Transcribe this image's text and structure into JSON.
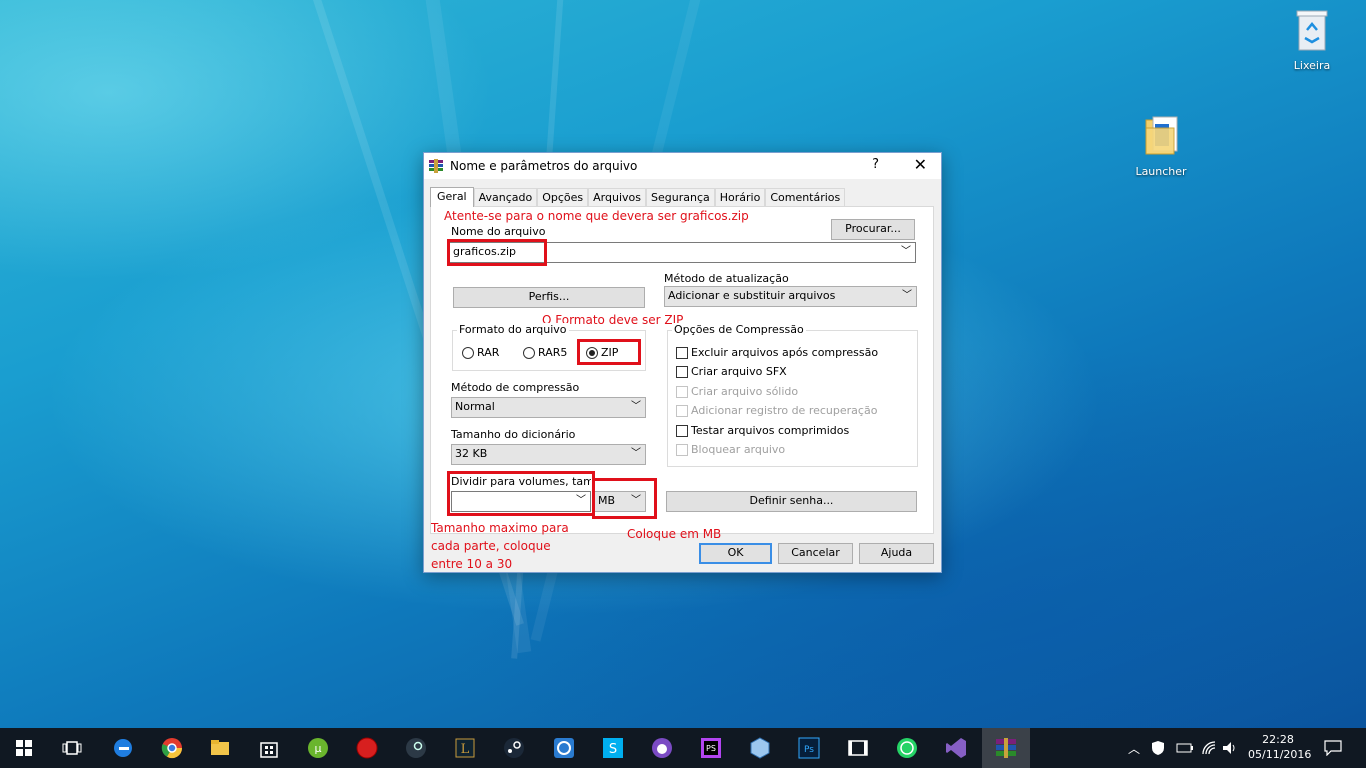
{
  "desktop": {
    "icons": [
      {
        "label": "Lixeira",
        "icon": "recycle-bin-icon"
      },
      {
        "label": "Launcher",
        "icon": "folder-icon"
      }
    ]
  },
  "dialog": {
    "title": "Nome e parâmetros do arquivo",
    "help_label": "?",
    "close_label": "✕",
    "tabs": [
      "Geral",
      "Avançado",
      "Opções",
      "Arquivos",
      "Segurança",
      "Horário",
      "Comentários"
    ],
    "active_tab": "Geral",
    "file_name_label": "Nome do arquivo",
    "file_name_value": "graficos.zip",
    "browse_button": "Procurar...",
    "profiles_button": "Perfis...",
    "update_method_label": "Método de atualização",
    "update_method_value": "Adicionar e substituir arquivos",
    "format_group_label": "Formato do arquivo",
    "formats": [
      {
        "label": "RAR",
        "selected": false
      },
      {
        "label": "RAR5",
        "selected": false
      },
      {
        "label": "ZIP",
        "selected": true
      }
    ],
    "compression_method_label": "Método de compressão",
    "compression_method_value": "Normal",
    "dictionary_size_label": "Tamanho do dicionário",
    "dictionary_size_value": "32 KB",
    "split_label": "Dividir para volumes, tamanho",
    "split_value": "",
    "split_unit": "MB",
    "options_group_label": "Opções de Compressão",
    "options": [
      {
        "label": "Excluir arquivos após compressão",
        "checked": false,
        "enabled": true
      },
      {
        "label": "Criar arquivo SFX",
        "checked": false,
        "enabled": true
      },
      {
        "label": "Criar arquivo sólido",
        "checked": false,
        "enabled": false
      },
      {
        "label": "Adicionar registro de recuperação",
        "checked": false,
        "enabled": false
      },
      {
        "label": "Testar arquivos comprimidos",
        "checked": false,
        "enabled": true
      },
      {
        "label": "Bloquear arquivo",
        "checked": false,
        "enabled": false
      }
    ],
    "set_password_button": "Definir senha...",
    "ok_button": "OK",
    "cancel_button": "Cancelar",
    "help_button": "Ajuda"
  },
  "annotations": {
    "name_note": "Atente-se para o nome que devera ser graficos.zip",
    "format_note": "O Formato deve ser ZIP",
    "size_note_line1": "Tamanho maximo para",
    "size_note_line2": "cada parte, coloque",
    "size_note_line3": "entre 10 a 30",
    "unit_note": "Coloque em MB",
    "highlight_color": "#e0101a"
  },
  "taskbar": {
    "apps": [
      "start-icon",
      "task-view-icon",
      "edge-icon",
      "chrome-icon",
      "file-explorer-icon",
      "store-icon",
      "utorrent-icon",
      "record-icon",
      "steam-like-icon",
      "league-icon",
      "steam-icon",
      "uplay-icon",
      "skype-icon",
      "chat-icon",
      "phpstorm-icon",
      "virtualbox-icon",
      "photoshop-icon",
      "video-editor-icon",
      "whatsapp-icon",
      "visual-studio-icon",
      "winrar-icon"
    ],
    "time": "22:28",
    "date": "05/11/2016"
  }
}
